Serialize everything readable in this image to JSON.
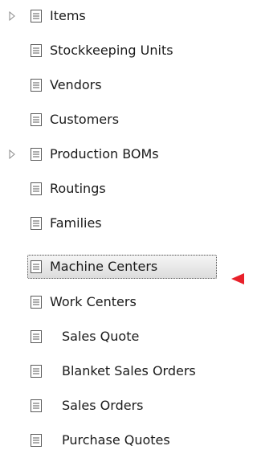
{
  "tree": {
    "items": [
      {
        "label": "Items",
        "expandable": true,
        "icon": "document-icon"
      },
      {
        "label": "Stockkeeping Units",
        "expandable": false,
        "icon": "document-icon"
      },
      {
        "label": "Vendors",
        "expandable": false,
        "icon": "document-icon"
      },
      {
        "label": "Customers",
        "expandable": false,
        "icon": "document-icon"
      },
      {
        "label": "Production BOMs",
        "expandable": true,
        "icon": "document-icon"
      },
      {
        "label": "Routings",
        "expandable": false,
        "icon": "document-icon"
      },
      {
        "label": "Families",
        "expandable": false,
        "icon": "document-icon"
      },
      {
        "label": "Machine Centers",
        "expandable": false,
        "selected": true,
        "icon": "document-icon"
      },
      {
        "label": "Work Centers",
        "expandable": false,
        "icon": "document-icon"
      },
      {
        "label": "Sales Quote",
        "expandable": false,
        "icon": "document-icon"
      },
      {
        "label": "Blanket Sales Orders",
        "expandable": false,
        "icon": "document-icon"
      },
      {
        "label": "Sales Orders",
        "expandable": false,
        "icon": "document-icon"
      },
      {
        "label": "Purchase Quotes",
        "expandable": false,
        "icon": "document-icon"
      }
    ]
  },
  "colors": {
    "pointer_arrow": "#e8202a",
    "selection_bg": "#dcdcdc"
  }
}
